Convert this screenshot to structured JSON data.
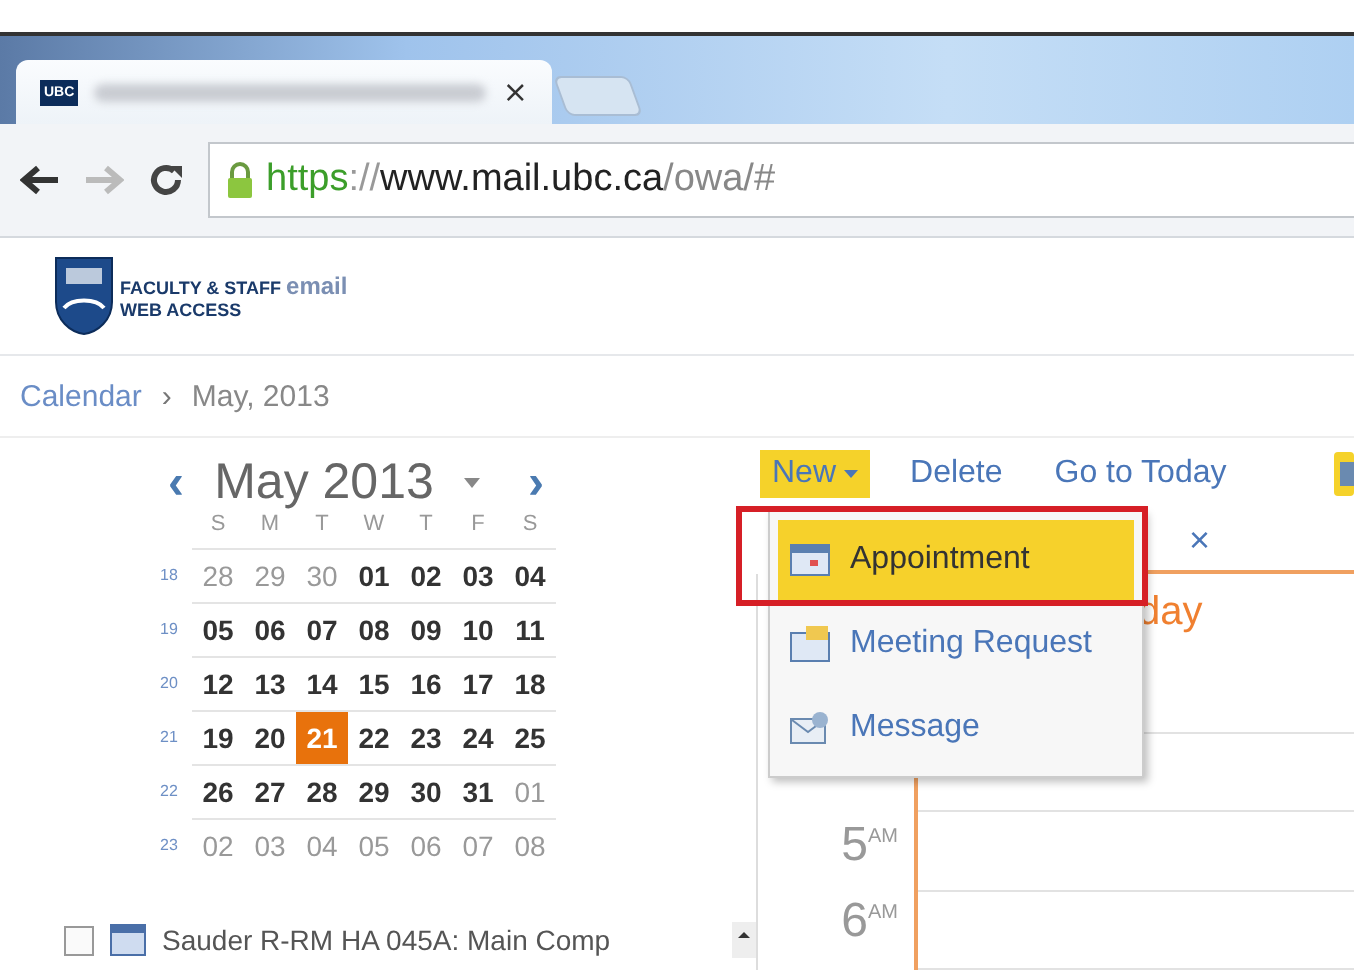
{
  "browser": {
    "tab": {
      "favicon_text": "UBC",
      "close": "×"
    },
    "url": {
      "scheme": "https",
      "separator": "://",
      "host": "www.mail.ubc.ca",
      "path": "/owa/#"
    }
  },
  "header": {
    "logo_line1": "FACULTY & STAFF",
    "logo_accent": "email",
    "logo_line2": "WEB ACCESS"
  },
  "breadcrumb": {
    "items": [
      "Calendar",
      "May, 2013"
    ],
    "separator": "›"
  },
  "mini_calendar": {
    "prev": "‹",
    "title": "May 2013",
    "next": "›",
    "weekdays": [
      "S",
      "M",
      "T",
      "W",
      "T",
      "F",
      "S"
    ],
    "weeks": [
      {
        "number": "18",
        "days": [
          {
            "label": "28",
            "in_month": false,
            "selected": false
          },
          {
            "label": "29",
            "in_month": false,
            "selected": false
          },
          {
            "label": "30",
            "in_month": false,
            "selected": false
          },
          {
            "label": "01",
            "in_month": true,
            "selected": false
          },
          {
            "label": "02",
            "in_month": true,
            "selected": false
          },
          {
            "label": "03",
            "in_month": true,
            "selected": false
          },
          {
            "label": "04",
            "in_month": true,
            "selected": false
          }
        ]
      },
      {
        "number": "19",
        "days": [
          {
            "label": "05",
            "in_month": true,
            "selected": false
          },
          {
            "label": "06",
            "in_month": true,
            "selected": false
          },
          {
            "label": "07",
            "in_month": true,
            "selected": false
          },
          {
            "label": "08",
            "in_month": true,
            "selected": false
          },
          {
            "label": "09",
            "in_month": true,
            "selected": false
          },
          {
            "label": "10",
            "in_month": true,
            "selected": false
          },
          {
            "label": "11",
            "in_month": true,
            "selected": false
          }
        ]
      },
      {
        "number": "20",
        "days": [
          {
            "label": "12",
            "in_month": true,
            "selected": false
          },
          {
            "label": "13",
            "in_month": true,
            "selected": false
          },
          {
            "label": "14",
            "in_month": true,
            "selected": false
          },
          {
            "label": "15",
            "in_month": true,
            "selected": false
          },
          {
            "label": "16",
            "in_month": true,
            "selected": false
          },
          {
            "label": "17",
            "in_month": true,
            "selected": false
          },
          {
            "label": "18",
            "in_month": true,
            "selected": false
          }
        ]
      },
      {
        "number": "21",
        "days": [
          {
            "label": "19",
            "in_month": true,
            "selected": false
          },
          {
            "label": "20",
            "in_month": true,
            "selected": false
          },
          {
            "label": "21",
            "in_month": true,
            "selected": true
          },
          {
            "label": "22",
            "in_month": true,
            "selected": false
          },
          {
            "label": "23",
            "in_month": true,
            "selected": false
          },
          {
            "label": "24",
            "in_month": true,
            "selected": false
          },
          {
            "label": "25",
            "in_month": true,
            "selected": false
          }
        ]
      },
      {
        "number": "22",
        "days": [
          {
            "label": "26",
            "in_month": true,
            "selected": false
          },
          {
            "label": "27",
            "in_month": true,
            "selected": false
          },
          {
            "label": "28",
            "in_month": true,
            "selected": false
          },
          {
            "label": "29",
            "in_month": true,
            "selected": false
          },
          {
            "label": "30",
            "in_month": true,
            "selected": false
          },
          {
            "label": "31",
            "in_month": true,
            "selected": false
          },
          {
            "label": "01",
            "in_month": false,
            "selected": false
          }
        ]
      },
      {
        "number": "23",
        "days": [
          {
            "label": "02",
            "in_month": false,
            "selected": false
          },
          {
            "label": "03",
            "in_month": false,
            "selected": false
          },
          {
            "label": "04",
            "in_month": false,
            "selected": false
          },
          {
            "label": "05",
            "in_month": false,
            "selected": false
          },
          {
            "label": "06",
            "in_month": false,
            "selected": false
          },
          {
            "label": "07",
            "in_month": false,
            "selected": false
          },
          {
            "label": "08",
            "in_month": false,
            "selected": false
          }
        ]
      }
    ]
  },
  "calendars": [
    {
      "label": "Sauder R-RM HA 045A: Main Comp",
      "checked": false
    }
  ],
  "toolbar": [
    {
      "label": "New",
      "kind": "dropdown",
      "selected": true
    },
    {
      "label": "Delete",
      "kind": "button",
      "selected": false
    },
    {
      "label": "Go to Today",
      "kind": "button",
      "selected": false
    }
  ],
  "new_menu": [
    {
      "label": "Appointment",
      "kind": "appointment",
      "selected": true
    },
    {
      "label": "Meeting Request",
      "kind": "meeting",
      "selected": false
    },
    {
      "label": "Message",
      "kind": "message",
      "selected": false
    }
  ],
  "day_view": {
    "close": "×",
    "title_fragment": "day",
    "times": [
      {
        "hour": "5",
        "suffix": "AM"
      },
      {
        "hour": "6",
        "suffix": "AM"
      }
    ]
  }
}
